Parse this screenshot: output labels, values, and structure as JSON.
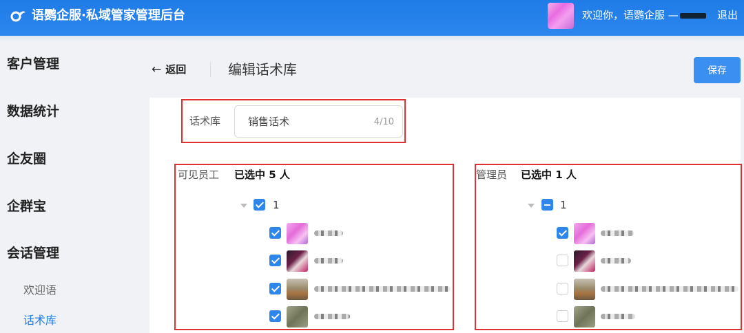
{
  "app": {
    "title": "语鹦企服·私域管家管理后台",
    "welcome": "欢迎你，语鹦企服 —",
    "logout": "退出"
  },
  "sidebar": {
    "items": [
      {
        "label": "客户管理"
      },
      {
        "label": "数据统计"
      },
      {
        "label": "企友圈"
      },
      {
        "label": "企群宝"
      },
      {
        "label": "会话管理"
      }
    ],
    "subitems": [
      {
        "label": "欢迎语",
        "active": false
      },
      {
        "label": "话术库",
        "active": true
      }
    ]
  },
  "header": {
    "back_label": "返回",
    "page_title": "编辑话术库",
    "save_label": "保存"
  },
  "form": {
    "library_label": "话术库",
    "library_value": "销售话术",
    "library_counter": "4/10"
  },
  "visible_staff": {
    "label": "可见员工",
    "selected": "已选中 5 人",
    "group": "1",
    "group_state": "checked",
    "members": [
      {
        "avatar": "pink",
        "checked": true
      },
      {
        "avatar": "dark",
        "checked": true
      },
      {
        "avatar": "brown",
        "checked": true
      },
      {
        "avatar": "olive",
        "checked": true
      }
    ]
  },
  "admins": {
    "label": "管理员",
    "selected": "已选中 1 人",
    "group": "1",
    "group_state": "partial",
    "members": [
      {
        "avatar": "pink",
        "checked": true
      },
      {
        "avatar": "dark",
        "checked": false
      },
      {
        "avatar": "brown",
        "checked": false
      },
      {
        "avatar": "olive",
        "checked": false
      }
    ]
  },
  "colors": {
    "brand": "#2c87ee",
    "highlight_border": "#e03030",
    "checkbox": "#2f86ea"
  }
}
